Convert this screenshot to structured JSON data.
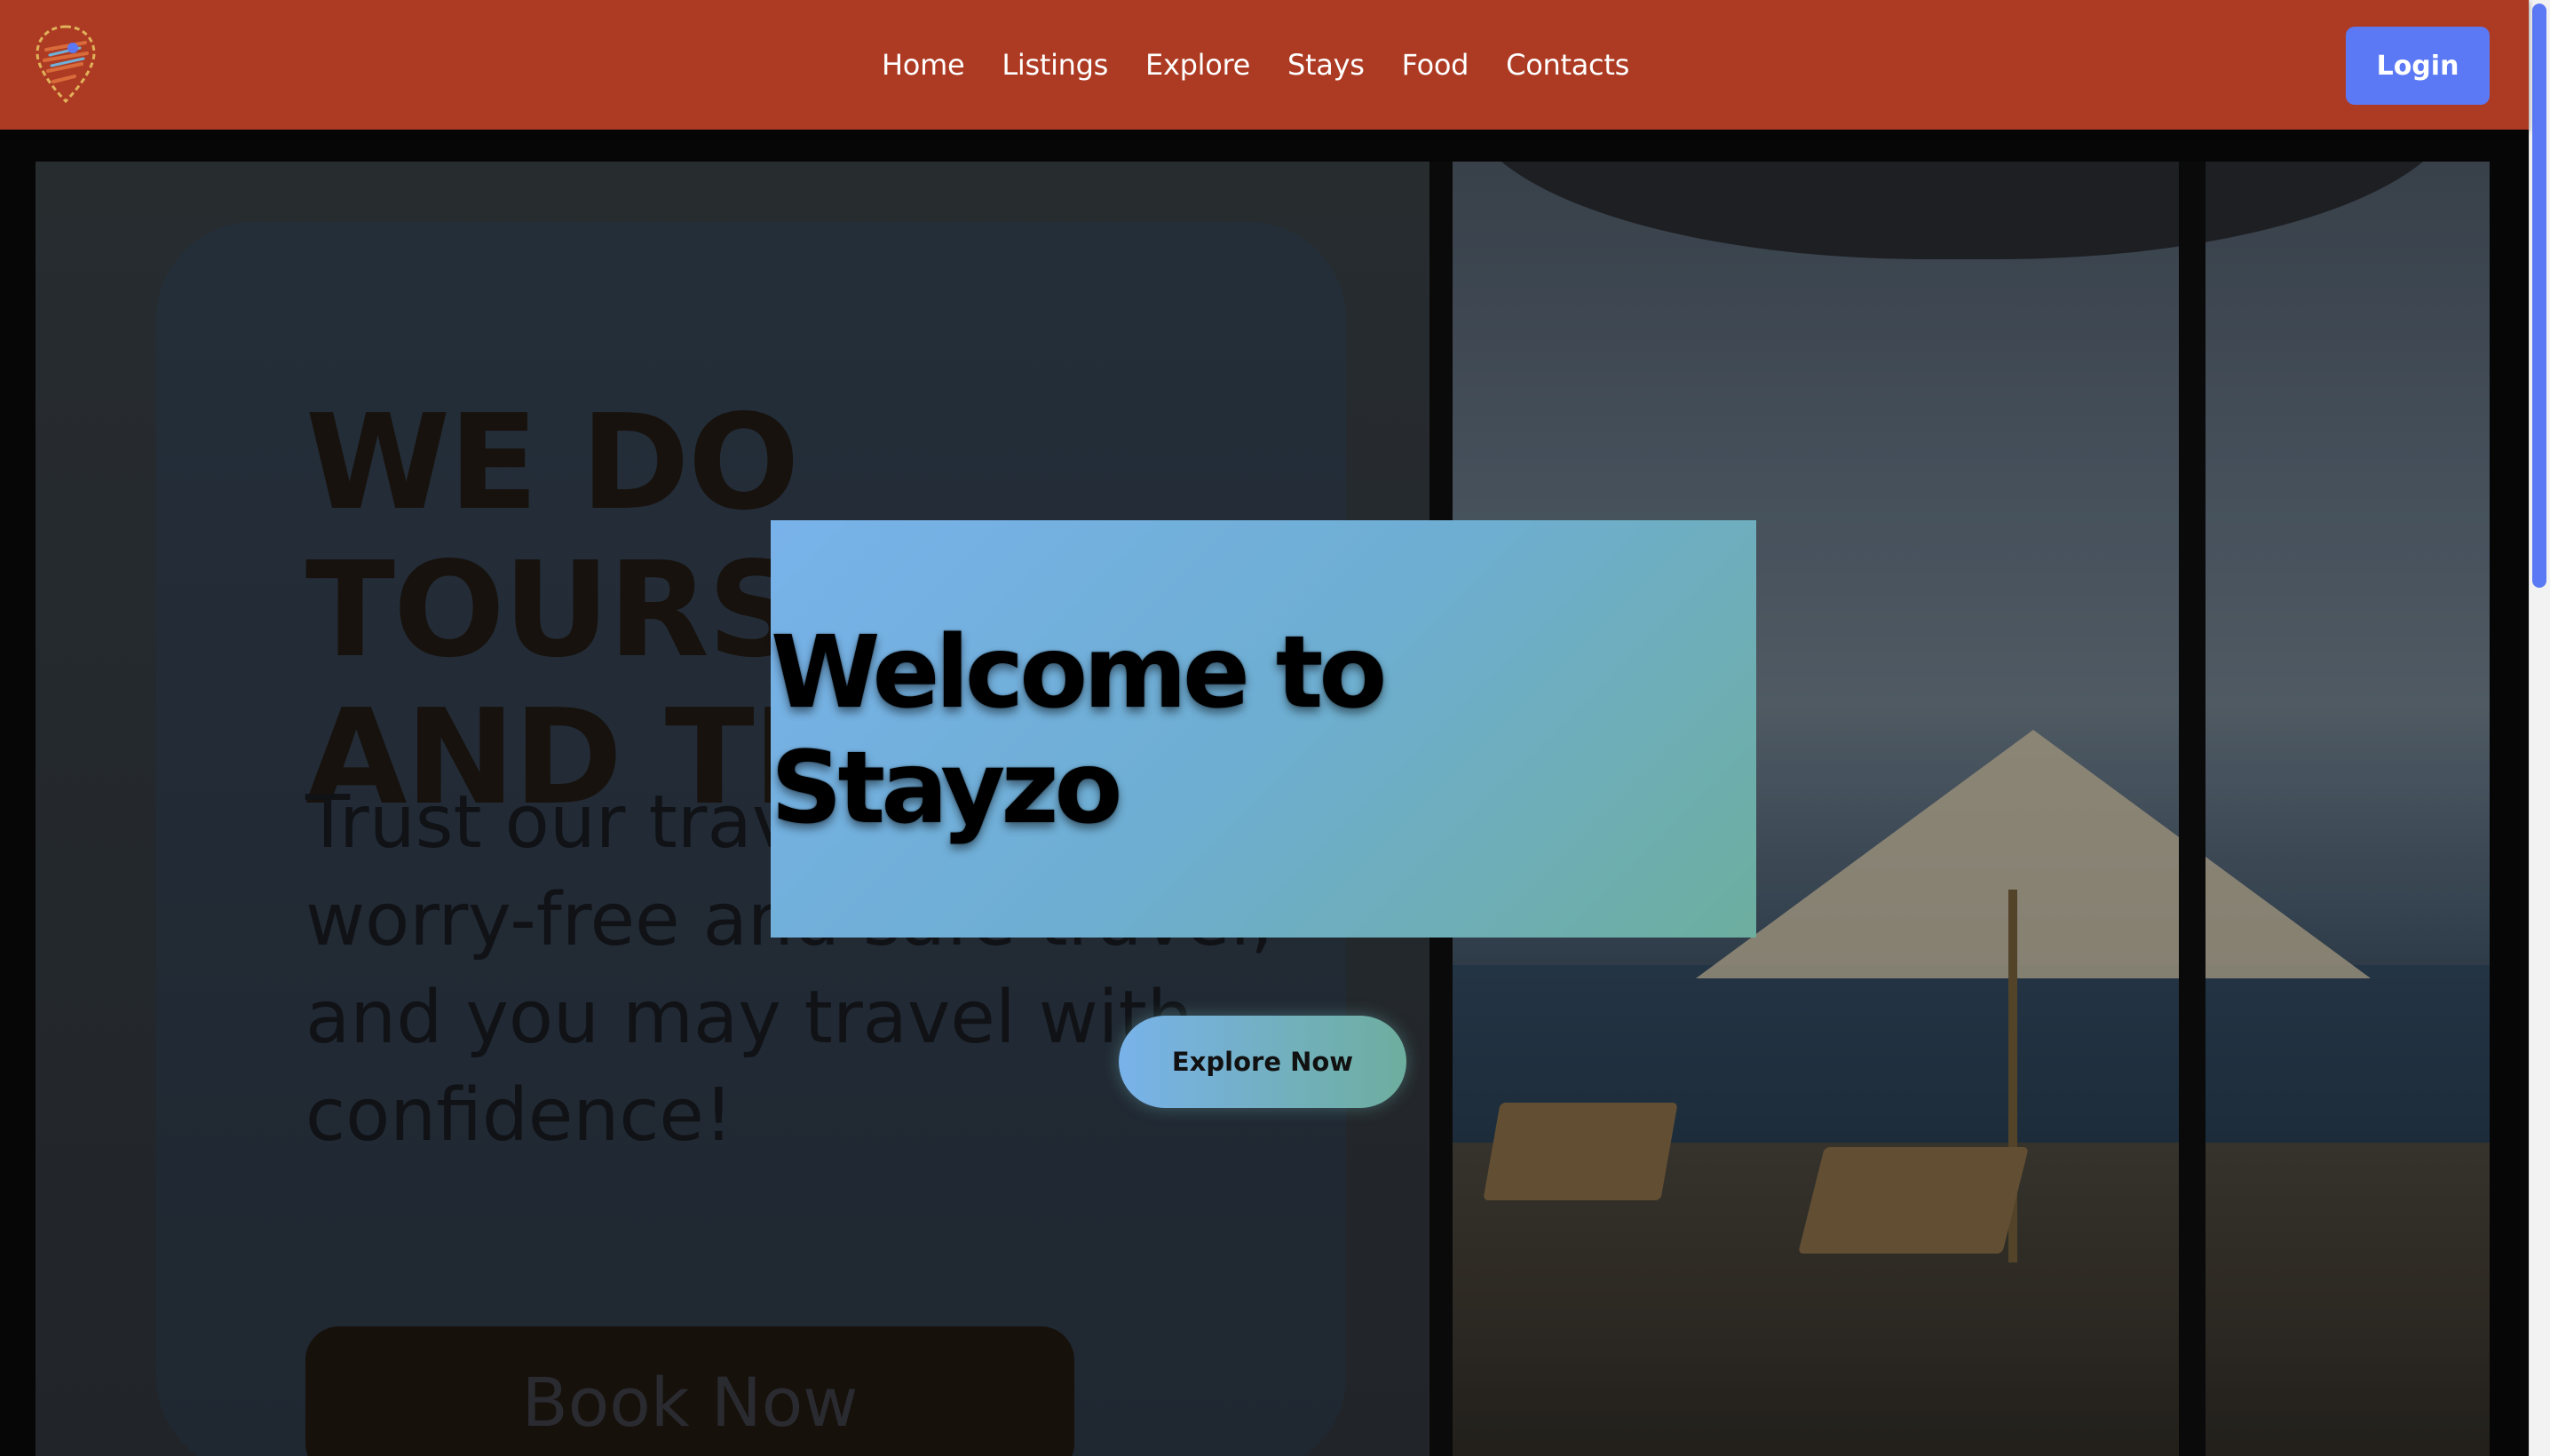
{
  "navbar": {
    "logo_alt": "Stayzo logo",
    "links": [
      "Home",
      "Listings",
      "Explore",
      "Stays",
      "Food",
      "Contacts"
    ],
    "login_label": "Login"
  },
  "hero": {
    "poster": {
      "heading_line1": "WE DO TOURS",
      "heading_line2": "AND TR",
      "text_line1": "Trust our trave",
      "text_line2": "worry-free and safe travel,",
      "text_line3": "and you may travel with",
      "text_line4": "confidence!",
      "button_label": "Book Now"
    },
    "title": "Welcome to Stayzo",
    "cta_label": "Explore Now"
  },
  "colors": {
    "navbar": "#ad3b23",
    "login_button": "#5b79f4",
    "card_gradient_start": "#78b2ea",
    "card_gradient_end": "#6dae9f",
    "scrollbar_thumb": "#5b79f4"
  },
  "icons": {
    "logo": "map-pin-logo-icon"
  }
}
